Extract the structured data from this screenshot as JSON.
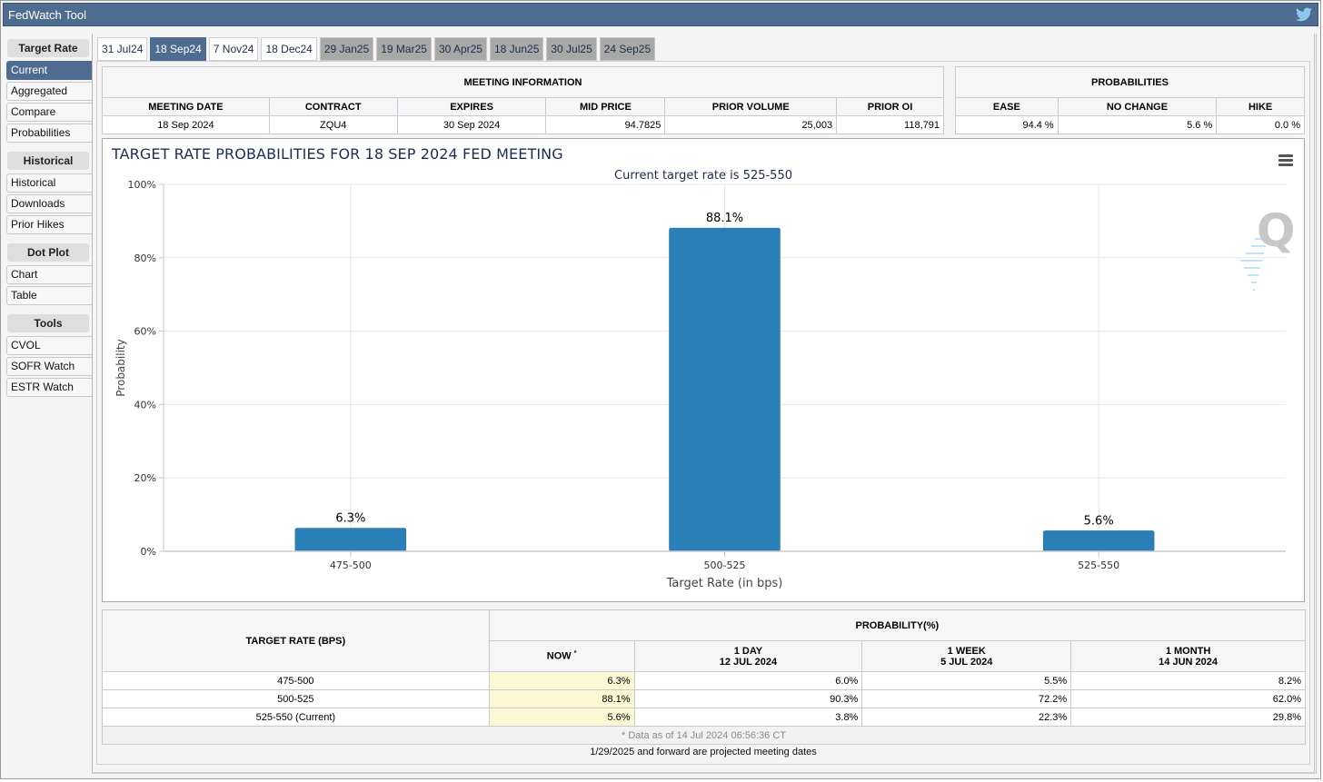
{
  "app": {
    "title": "FedWatch Tool",
    "share_icon": "twitter-bird-icon"
  },
  "sidebar": {
    "sections": [
      {
        "heading": "Target Rate",
        "items": [
          {
            "label": "Current",
            "active": true
          },
          {
            "label": "Aggregated",
            "active": false
          },
          {
            "label": "Compare",
            "active": false
          },
          {
            "label": "Probabilities",
            "active": false
          }
        ]
      },
      {
        "heading": "Historical",
        "items": [
          {
            "label": "Historical",
            "active": false
          },
          {
            "label": "Downloads",
            "active": false
          },
          {
            "label": "Prior Hikes",
            "active": false
          }
        ]
      },
      {
        "heading": "Dot Plot",
        "items": [
          {
            "label": "Chart",
            "active": false
          },
          {
            "label": "Table",
            "active": false
          }
        ]
      },
      {
        "heading": "Tools",
        "items": [
          {
            "label": "CVOL",
            "active": false
          },
          {
            "label": "SOFR Watch",
            "active": false
          },
          {
            "label": "ESTR Watch",
            "active": false
          }
        ]
      }
    ]
  },
  "tabs": [
    {
      "label": "31 Jul24",
      "state": "normal"
    },
    {
      "label": "18 Sep24",
      "state": "active"
    },
    {
      "label": "7 Nov24",
      "state": "normal"
    },
    {
      "label": "18 Dec24",
      "state": "normal"
    },
    {
      "label": "29 Jan25",
      "state": "projected"
    },
    {
      "label": "19 Mar25",
      "state": "projected"
    },
    {
      "label": "30 Apr25",
      "state": "projected"
    },
    {
      "label": "18 Jun25",
      "state": "projected"
    },
    {
      "label": "30 Jul25",
      "state": "projected"
    },
    {
      "label": "24 Sep25",
      "state": "projected"
    }
  ],
  "meeting_info": {
    "heading": "MEETING INFORMATION",
    "columns": [
      "MEETING DATE",
      "CONTRACT",
      "EXPIRES",
      "MID PRICE",
      "PRIOR VOLUME",
      "PRIOR OI"
    ],
    "values": [
      "18 Sep 2024",
      "ZQU4",
      "30 Sep 2024",
      "94.7825",
      "25,003",
      "118,791"
    ]
  },
  "probabilities": {
    "heading": "PROBABILITIES",
    "columns": [
      "EASE",
      "NO CHANGE",
      "HIKE"
    ],
    "values": [
      "94.4 %",
      "5.6 %",
      "0.0 %"
    ]
  },
  "chart_menu_icon": "hamburger-menu-icon",
  "watermark_icon": "quikstrike-q-logo",
  "chart_data": {
    "type": "bar",
    "title": "TARGET RATE PROBABILITIES FOR 18 SEP 2024 FED MEETING",
    "subtitle": "Current target rate is 525-550",
    "xlabel": "Target Rate (in bps)",
    "ylabel": "Probability",
    "categories": [
      "475-500",
      "500-525",
      "525-550"
    ],
    "values": [
      6.3,
      88.1,
      5.6
    ],
    "data_labels": [
      "6.3%",
      "88.1%",
      "5.6%"
    ],
    "ylim": [
      0,
      100
    ],
    "yticks": [
      0,
      20,
      40,
      60,
      80,
      100
    ],
    "ytick_labels": [
      "0%",
      "20%",
      "40%",
      "60%",
      "80%",
      "100%"
    ],
    "grid": true,
    "legend": "none",
    "bar_color": "#2a7fb8"
  },
  "history_table": {
    "rate_header": "TARGET RATE (BPS)",
    "group_header": "PROBABILITY(%)",
    "columns": [
      {
        "line1": "NOW",
        "line2": "",
        "asterisk": "*"
      },
      {
        "line1": "1 DAY",
        "line2": "12 JUL 2024"
      },
      {
        "line1": "1 WEEK",
        "line2": "5 JUL 2024"
      },
      {
        "line1": "1 MONTH",
        "line2": "14 JUN 2024"
      }
    ],
    "rows": [
      {
        "rate": "475-500",
        "now": "6.3%",
        "day": "6.0%",
        "week": "5.5%",
        "month": "8.2%"
      },
      {
        "rate": "500-525",
        "now": "88.1%",
        "day": "90.3%",
        "week": "72.2%",
        "month": "62.0%"
      },
      {
        "rate": "525-550 (Current)",
        "now": "5.6%",
        "day": "3.8%",
        "week": "22.3%",
        "month": "29.8%"
      }
    ],
    "footnote": "* Data as of 14 Jul 2024 06:56:36 CT"
  },
  "projected_note": "1/29/2025 and forward are projected meeting dates"
}
